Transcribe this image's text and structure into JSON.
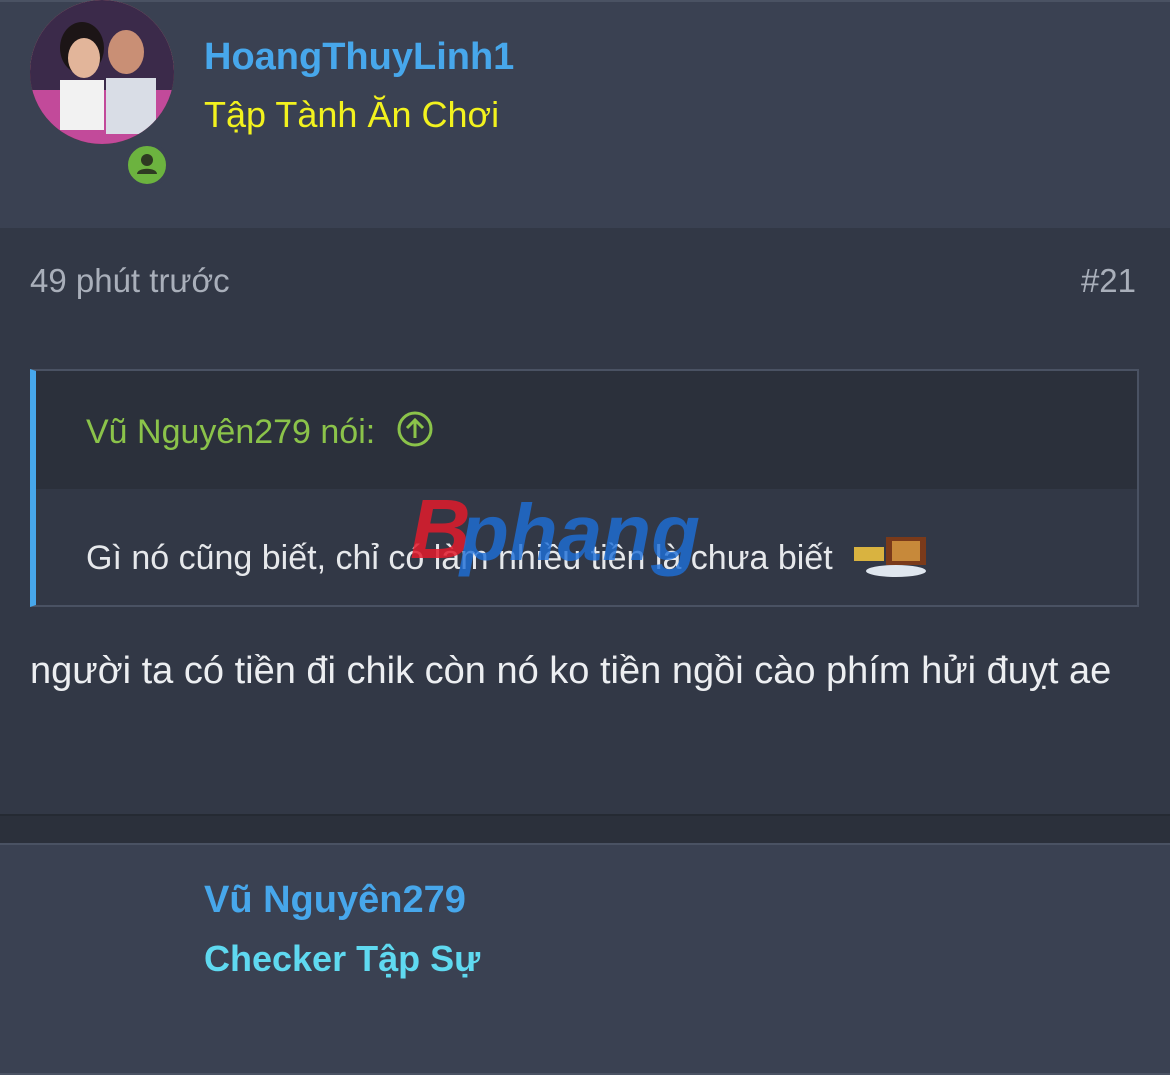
{
  "users": {
    "author": {
      "name": "HoangThuyLinh1",
      "title": "Tập Tành Ăn Chơi",
      "title_color": "#f2f21e"
    },
    "next": {
      "name": "Vũ Nguyên279",
      "title": "Checker Tập Sự",
      "title_color": "#5fd9f0"
    }
  },
  "post": {
    "timestamp": "49 phút trước",
    "number": "#21",
    "quote": {
      "author": "Vũ Nguyên279 nói:",
      "text": "Gì nó cũng biết, chỉ có làm nhiều tiền là chưa biết"
    },
    "text": "người ta có tiền đi chik còn nó ko tiền ngồi cào phím hửi đuỵt ae"
  },
  "icons": {
    "online": "person-circle-icon",
    "quote_jump": "arrow-up-circle-icon",
    "emoji": "money-sticker-icon"
  },
  "watermark": "phang"
}
